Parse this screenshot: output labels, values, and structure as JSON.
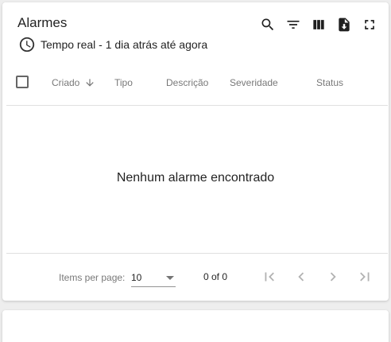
{
  "widget": {
    "title": "Alarmes",
    "timewindow": "Tempo real - 1 dia atrás até agora"
  },
  "toolbar": {
    "icons": [
      "search-icon",
      "filter-icon",
      "columns-icon",
      "export-icon",
      "fullscreen-icon"
    ]
  },
  "table": {
    "columns": {
      "created": "Criado",
      "type": "Tipo",
      "description": "Descrição",
      "severity": "Severidade",
      "status": "Status"
    },
    "sort_column": "created",
    "sort_direction": "desc",
    "empty_message": "Nenhum alarme encontrado"
  },
  "paginator": {
    "items_per_page_label": "Items per page:",
    "page_size": "10",
    "range_label": "0 of 0"
  },
  "colors": {
    "background": "#eeeeee",
    "card": "#ffffff",
    "divider": "#e0e0e0"
  }
}
